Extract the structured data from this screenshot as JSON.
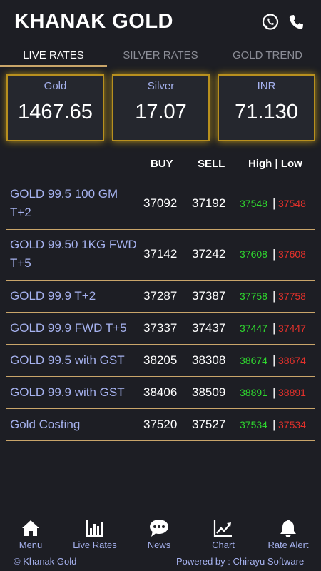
{
  "header": {
    "title": "KHANAK GOLD",
    "icons": [
      "whatsapp-icon",
      "phone-icon"
    ]
  },
  "tabs": [
    {
      "label": "LIVE RATES",
      "active": true
    },
    {
      "label": "SILVER RATES",
      "active": false
    },
    {
      "label": "GOLD TREND",
      "active": false
    }
  ],
  "cards": [
    {
      "label": "Gold",
      "value": "1467.65"
    },
    {
      "label": "Silver",
      "value": "17.07"
    },
    {
      "label": "INR",
      "value": "71.130"
    }
  ],
  "table": {
    "columns": {
      "buy": "BUY",
      "sell": "SELL",
      "high_low": "High | Low"
    },
    "separator": "|",
    "rows": [
      {
        "name": "GOLD 99.5 100 GM T+2",
        "buy": "37092",
        "sell": "37192",
        "high": "37548",
        "low": "37548"
      },
      {
        "name": "GOLD 99.50 1KG FWD T+5",
        "buy": "37142",
        "sell": "37242",
        "high": "37608",
        "low": "37608"
      },
      {
        "name": "GOLD 99.9 T+2",
        "buy": "37287",
        "sell": "37387",
        "high": "37758",
        "low": "37758"
      },
      {
        "name": "GOLD 99.9 FWD T+5",
        "buy": "37337",
        "sell": "37437",
        "high": "37447",
        "low": "37447"
      },
      {
        "name": "GOLD 99.5 with GST",
        "buy": "38205",
        "sell": "38308",
        "high": "38674",
        "low": "38674"
      },
      {
        "name": "GOLD 99.9 with GST",
        "buy": "38406",
        "sell": "38509",
        "high": "38891",
        "low": "38891"
      },
      {
        "name": "Gold Costing",
        "buy": "37520",
        "sell": "37527",
        "high": "37534",
        "low": "37534"
      }
    ]
  },
  "nav": [
    {
      "label": "Menu",
      "icon": "home-icon"
    },
    {
      "label": "Live Rates",
      "icon": "bar-chart-icon"
    },
    {
      "label": "News",
      "icon": "chat-bubble-icon"
    },
    {
      "label": "Chart",
      "icon": "line-chart-icon"
    },
    {
      "label": "Rate Alert",
      "icon": "bell-icon"
    }
  ],
  "footer": {
    "left": "© Khanak Gold",
    "right": "Powered by : Chirayu Software"
  },
  "colors": {
    "background": "#1d1e24",
    "gold_accent": "#c9a56a",
    "card_glow": "#e2b214",
    "label": "#a6b2ef",
    "high": "#2fd82f",
    "low": "#e5312b"
  }
}
